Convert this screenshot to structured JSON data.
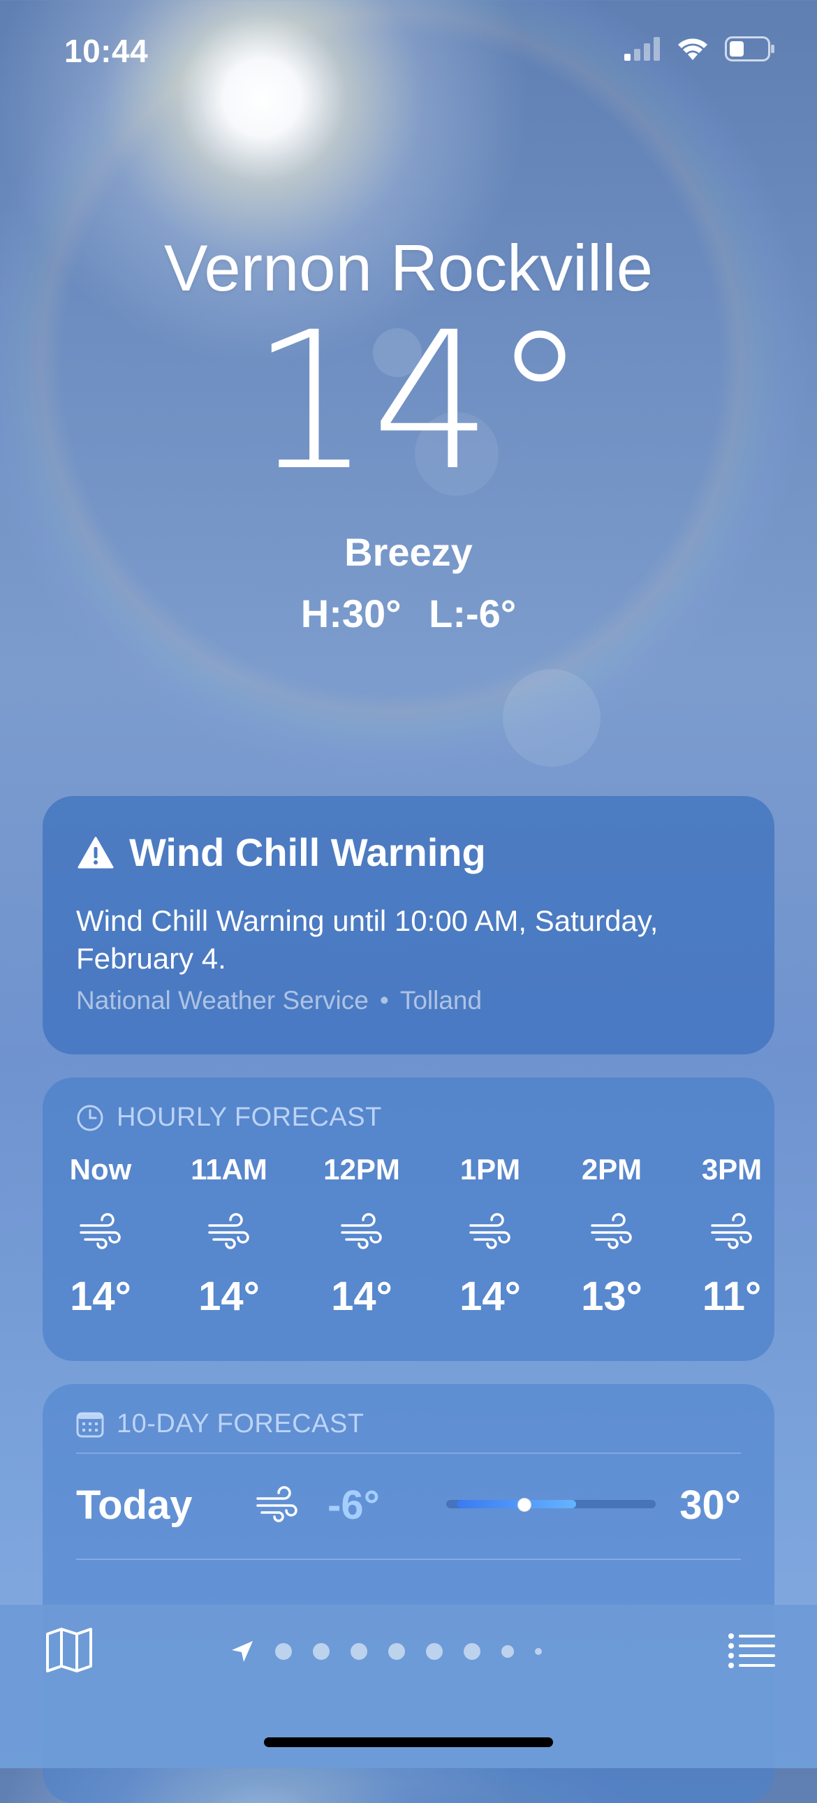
{
  "status_bar": {
    "time": "10:44"
  },
  "location": {
    "city": "Vernon Rockville",
    "temperature": "14°",
    "condition": "Breezy",
    "high": "H:30°",
    "low": "L:-6°"
  },
  "alert": {
    "title": "Wind Chill Warning",
    "body": "Wind Chill Warning until 10:00 AM, Saturday, February 4.",
    "source": "National Weather Service",
    "region": "Tolland"
  },
  "hourly": {
    "header": "HOURLY FORECAST",
    "items": [
      {
        "label": "Now",
        "icon": "wind-icon",
        "temp": "14°"
      },
      {
        "label": "11AM",
        "icon": "wind-icon",
        "temp": "14°"
      },
      {
        "label": "12PM",
        "icon": "wind-icon",
        "temp": "14°"
      },
      {
        "label": "1PM",
        "icon": "wind-icon",
        "temp": "14°"
      },
      {
        "label": "2PM",
        "icon": "wind-icon",
        "temp": "13°"
      },
      {
        "label": "3PM",
        "icon": "wind-icon",
        "temp": "11°"
      }
    ]
  },
  "ten_day": {
    "header": "10-DAY FORECAST",
    "days": [
      {
        "name": "Today",
        "icon": "wind-icon",
        "low": "-6°",
        "high": "30°",
        "range_start": 0.05,
        "range_end": 0.62,
        "current": 0.37
      }
    ]
  },
  "toolbar": {
    "map_icon": "map-icon",
    "list_icon": "list-icon",
    "page_count": 9,
    "current_page": "location-arrow-icon"
  },
  "colors": {
    "sky_top": "#5f7fb3",
    "sky_bottom": "#86abe0",
    "range_low": "#3a7af0",
    "range_high": "#66b3ff",
    "low_temp_text": "#aad2ff"
  }
}
